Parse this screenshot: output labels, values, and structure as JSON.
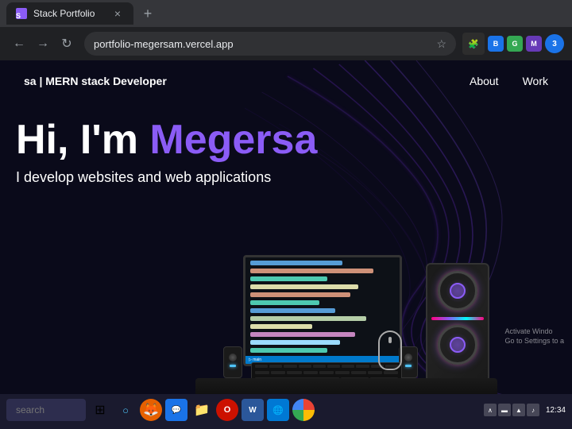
{
  "browser": {
    "tab": {
      "title": "Stack Portfolio",
      "favicon": "🟣"
    },
    "new_tab_icon": "+",
    "address": "portfolio-megersam.vercel.app",
    "nav": {
      "back": "←",
      "forward": "→",
      "refresh": "↻"
    },
    "star_icon": "☆",
    "extensions": [
      "🧩",
      "🟦",
      "🟢",
      "🟪"
    ]
  },
  "website": {
    "logo": "sa | MERN stack Developer",
    "nav_links": [
      {
        "label": "About",
        "href": "#about"
      },
      {
        "label": "Work",
        "href": "#work"
      }
    ],
    "hero": {
      "line1_normal": "Hi, I'm ",
      "line1_highlight": "Megersa",
      "subtitle": "I develop websites and web applications"
    },
    "activate_windows_line1": "Activate Windo",
    "activate_windows_line2": "Go to Settings to a"
  },
  "taskbar": {
    "search_placeholder": "search",
    "icons": [
      "⊞",
      "🔍",
      "🦊",
      "💬",
      "📁",
      "🔵",
      "📘",
      "🌐",
      "🟢"
    ],
    "tray": {
      "up_arrow": "∧",
      "battery": "🔋",
      "network": "📶",
      "volume": "🔊"
    }
  }
}
